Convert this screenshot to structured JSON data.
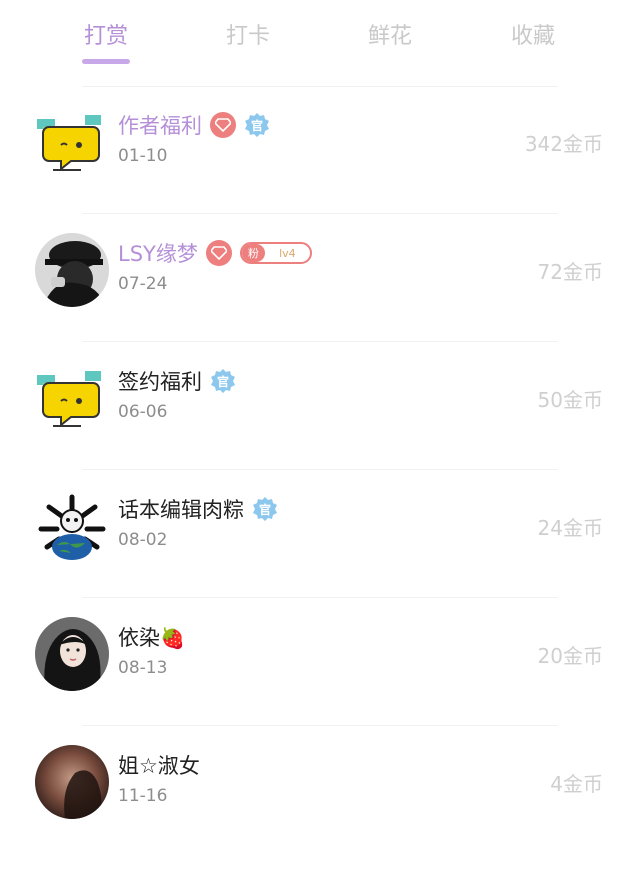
{
  "tabs": [
    {
      "label": "打赏",
      "active": true
    },
    {
      "label": "打卡",
      "active": false
    },
    {
      "label": "鲜花",
      "active": false
    },
    {
      "label": "收藏",
      "active": false
    }
  ],
  "rows": [
    {
      "name": "作者福利",
      "date": "01-10",
      "amount": "342金币",
      "avatar": "yellow-chat-bubble-avatar",
      "badges": [
        "gem",
        "official"
      ],
      "official_label": "官"
    },
    {
      "name": "LSY缘梦",
      "date": "07-24",
      "amount": "72金币",
      "avatar": "person-black-hat-avatar",
      "badges": [
        "gem",
        "fan"
      ],
      "fan_label": "粉",
      "fan_level": "lv4"
    },
    {
      "name": "签约福利",
      "date": "06-06",
      "amount": "50金币",
      "avatar": "yellow-chat-bubble-avatar",
      "badges": [
        "official"
      ],
      "official_label": "官"
    },
    {
      "name": "话本编辑肉粽",
      "date": "08-02",
      "amount": "24金币",
      "avatar": "earth-skull-avatar",
      "badges": [
        "official"
      ],
      "official_label": "官"
    },
    {
      "name": "依染",
      "name_emoji": "🍓",
      "date": "08-13",
      "amount": "20金币",
      "avatar": "girl-dark-hair-avatar",
      "badges": []
    },
    {
      "name": "姐☆淑女",
      "date": "11-16",
      "amount": "4金币",
      "avatar": "blurred-portrait-avatar",
      "badges": []
    }
  ],
  "colors": {
    "accent": "#b590d8",
    "gem": "#ee7f7f",
    "official": "#8cc8ee",
    "amount": "#cfcfcf"
  }
}
